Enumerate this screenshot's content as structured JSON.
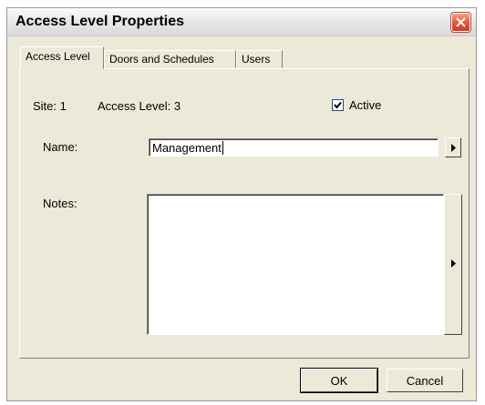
{
  "window": {
    "title": "Access Level Properties"
  },
  "tabs": [
    {
      "label": "Access Level",
      "active": true
    },
    {
      "label": "Doors and Schedules",
      "active": false
    },
    {
      "label": "Users",
      "active": false
    }
  ],
  "panel": {
    "site_text": "Site: 1",
    "access_level_text": "Access Level: 3",
    "active_label": "Active",
    "active_checked": true,
    "name_label": "Name:",
    "name_value": "Management",
    "notes_label": "Notes:",
    "notes_value": ""
  },
  "buttons": {
    "ok_label": "OK",
    "cancel_label": "Cancel"
  },
  "colors": {
    "dialog_bg": "#ece9d8",
    "close_button": "#e2563a",
    "field_bg": "#ffffff"
  },
  "icons": {
    "close": "close-icon",
    "checkmark": "checkmark-icon",
    "arrow": "arrow-right-icon"
  }
}
